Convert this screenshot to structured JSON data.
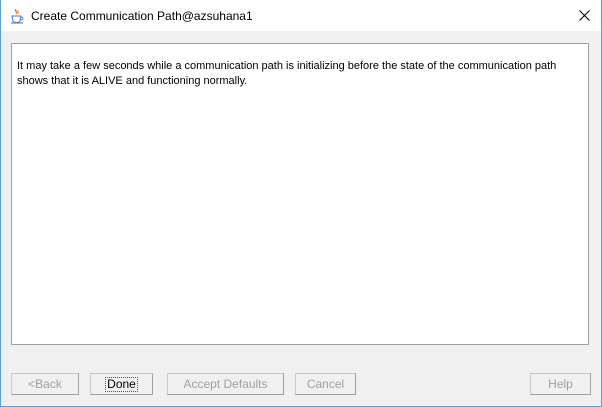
{
  "window": {
    "title": "Create Communication Path@azsuhana1",
    "app_icon": "java-cup-icon",
    "close_icon": "close-icon"
  },
  "content": {
    "message": "It may take a few seconds while a communication path is initializing before the state of the communication path shows that it is ALIVE and functioning normally."
  },
  "buttons": {
    "back": {
      "label": "<Back",
      "enabled": false
    },
    "done": {
      "label": "Done",
      "enabled": true
    },
    "accept_defaults": {
      "label": "Accept Defaults",
      "enabled": false
    },
    "cancel": {
      "label": "Cancel",
      "enabled": false
    },
    "help": {
      "label": "Help",
      "enabled": false
    }
  }
}
